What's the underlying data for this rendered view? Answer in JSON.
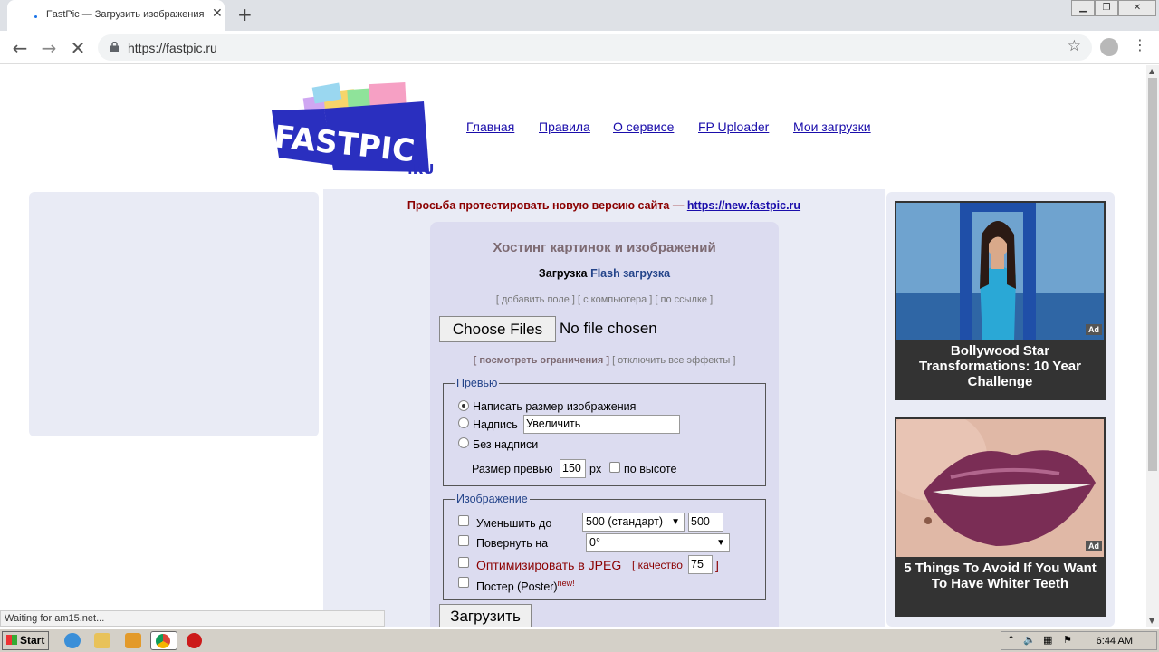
{
  "browser": {
    "tab_title": "FastPic — Загрузить изображения",
    "url": "https://fastpic.ru",
    "status": "Waiting for am15.net..."
  },
  "nav": {
    "items": [
      "Главная",
      "Правила",
      "О сервисе",
      "FP Uploader",
      "Мои загрузки"
    ]
  },
  "notice": {
    "text": "Просьба протестировать новую версию сайта — ",
    "link": "https://new.fastpic.ru"
  },
  "upload": {
    "heading": "Хостинг картинок и изображений",
    "tab_active": "Загрузка",
    "tab_flash": "Flash загрузка",
    "links_top": "[ добавить поле ] [ с компьютера ] [ по ссылке ]",
    "choose_files": "Choose Files",
    "no_file": "No file chosen",
    "view_limits": "[ посмотреть ограничения ]",
    "disable_effects": "[ отключить все эффекты ]",
    "preview": {
      "legend": "Превью",
      "opt_size": "Написать размер изображения",
      "opt_caption": "Надпись",
      "caption_value": "Увеличить",
      "opt_none": "Без надписи",
      "size_label": "Размер превью",
      "size_value": "150",
      "size_unit": "px",
      "by_height": "по высоте"
    },
    "image": {
      "legend": "Изображение",
      "reduce_label": "Уменьшить до",
      "reduce_select": "500 (стандарт)",
      "reduce_value": "500",
      "rotate_label": "Повернуть на",
      "rotate_select": "0°",
      "optimize_label": "Оптимизировать в JPEG",
      "quality_open": "[ качество",
      "quality_value": "75",
      "quality_close": "]",
      "poster_label": "Постер (Poster)",
      "poster_new": "new!"
    },
    "submit": "Загрузить"
  },
  "ads": [
    {
      "title": "Bollywood Star Transformations: 10 Year Challenge",
      "badge": "Ad"
    },
    {
      "title": "5 Things To Avoid If You Want To Have Whiter Teeth",
      "badge": "Ad"
    }
  ],
  "taskbar": {
    "start": "Start",
    "clock": "6:44 AM"
  },
  "colors": {
    "notice": "#8b0000",
    "link": "#1a0dab",
    "legend": "#24448a",
    "panel_bg": "#dcdcf0"
  }
}
